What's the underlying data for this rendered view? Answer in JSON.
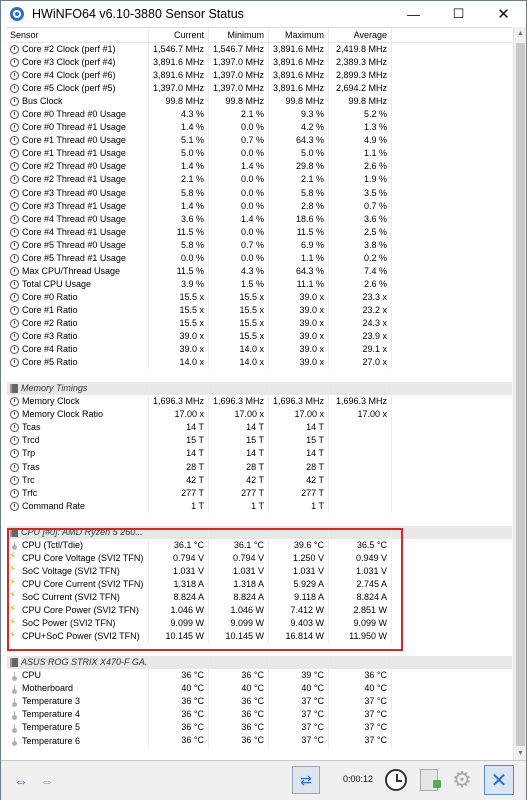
{
  "window": {
    "title": "HWiNFO64 v6.10-3880 Sensor Status"
  },
  "controls": {
    "minimize": "—",
    "maximize": "☐",
    "close": "✕"
  },
  "columns": [
    "Sensor",
    "Current",
    "Minimum",
    "Maximum",
    "Average"
  ],
  "rows": [
    {
      "type": "data",
      "icon": "clock",
      "label": "Core #2 Clock (perf #1)",
      "current": "1,546.7 MHz",
      "min": "1,546.7 MHz",
      "max": "3,891.6 MHz",
      "avg": "2,419.8 MHz"
    },
    {
      "type": "data",
      "icon": "clock",
      "label": "Core #3 Clock (perf #4)",
      "current": "3,891.6 MHz",
      "min": "1,397.0 MHz",
      "max": "3,891.6 MHz",
      "avg": "2,389.3 MHz"
    },
    {
      "type": "data",
      "icon": "clock",
      "label": "Core #4 Clock (perf #6)",
      "current": "3,891.6 MHz",
      "min": "1,397.0 MHz",
      "max": "3,891.6 MHz",
      "avg": "2,899.3 MHz"
    },
    {
      "type": "data",
      "icon": "clock",
      "label": "Core #5 Clock (perf #5)",
      "current": "1,397.0 MHz",
      "min": "1,397.0 MHz",
      "max": "3,891.6 MHz",
      "avg": "2,694.2 MHz"
    },
    {
      "type": "data",
      "icon": "clock",
      "label": "Bus Clock",
      "current": "99.8 MHz",
      "min": "99.8 MHz",
      "max": "99.8 MHz",
      "avg": "99.8 MHz"
    },
    {
      "type": "data",
      "icon": "clock",
      "label": "Core #0 Thread #0 Usage",
      "current": "4.3 %",
      "min": "2.1 %",
      "max": "9.3 %",
      "avg": "5.2 %"
    },
    {
      "type": "data",
      "icon": "clock",
      "label": "Core #0 Thread #1 Usage",
      "current": "1.4 %",
      "min": "0.0 %",
      "max": "4.2 %",
      "avg": "1.3 %"
    },
    {
      "type": "data",
      "icon": "clock",
      "label": "Core #1 Thread #0 Usage",
      "current": "5.1 %",
      "min": "0.7 %",
      "max": "64.3 %",
      "avg": "4.9 %"
    },
    {
      "type": "data",
      "icon": "clock",
      "label": "Core #1 Thread #1 Usage",
      "current": "5.0 %",
      "min": "0.0 %",
      "max": "5.0 %",
      "avg": "1.1 %"
    },
    {
      "type": "data",
      "icon": "clock",
      "label": "Core #2 Thread #0 Usage",
      "current": "1.4 %",
      "min": "1.4 %",
      "max": "29.8 %",
      "avg": "2.6 %"
    },
    {
      "type": "data",
      "icon": "clock",
      "label": "Core #2 Thread #1 Usage",
      "current": "2.1 %",
      "min": "0.0 %",
      "max": "2.1 %",
      "avg": "1.9 %"
    },
    {
      "type": "data",
      "icon": "clock",
      "label": "Core #3 Thread #0 Usage",
      "current": "5.8 %",
      "min": "0.0 %",
      "max": "5.8 %",
      "avg": "3.5 %"
    },
    {
      "type": "data",
      "icon": "clock",
      "label": "Core #3 Thread #1 Usage",
      "current": "1.4 %",
      "min": "0.0 %",
      "max": "2.8 %",
      "avg": "0.7 %"
    },
    {
      "type": "data",
      "icon": "clock",
      "label": "Core #4 Thread #0 Usage",
      "current": "3.6 %",
      "min": "1.4 %",
      "max": "18.6 %",
      "avg": "3.6 %"
    },
    {
      "type": "data",
      "icon": "clock",
      "label": "Core #4 Thread #1 Usage",
      "current": "11.5 %",
      "min": "0.0 %",
      "max": "11.5 %",
      "avg": "2.5 %"
    },
    {
      "type": "data",
      "icon": "clock",
      "label": "Core #5 Thread #0 Usage",
      "current": "5.8 %",
      "min": "0.7 %",
      "max": "6.9 %",
      "avg": "3.8 %"
    },
    {
      "type": "data",
      "icon": "clock",
      "label": "Core #5 Thread #1 Usage",
      "current": "0.0 %",
      "min": "0.0 %",
      "max": "1.1 %",
      "avg": "0.2 %"
    },
    {
      "type": "data",
      "icon": "clock",
      "label": "Max CPU/Thread Usage",
      "current": "11.5 %",
      "min": "4.3 %",
      "max": "64.3 %",
      "avg": "7.4 %"
    },
    {
      "type": "data",
      "icon": "clock",
      "label": "Total CPU Usage",
      "current": "3.9 %",
      "min": "1.5 %",
      "max": "11.1 %",
      "avg": "2.6 %"
    },
    {
      "type": "data",
      "icon": "clock",
      "label": "Core #0 Ratio",
      "current": "15.5 x",
      "min": "15.5 x",
      "max": "39.0 x",
      "avg": "23.3 x"
    },
    {
      "type": "data",
      "icon": "clock",
      "label": "Core #1 Ratio",
      "current": "15.5 x",
      "min": "15.5 x",
      "max": "39.0 x",
      "avg": "23.2 x"
    },
    {
      "type": "data",
      "icon": "clock",
      "label": "Core #2 Ratio",
      "current": "15.5 x",
      "min": "15.5 x",
      "max": "39.0 x",
      "avg": "24.3 x"
    },
    {
      "type": "data",
      "icon": "clock",
      "label": "Core #3 Ratio",
      "current": "39.0 x",
      "min": "15.5 x",
      "max": "39.0 x",
      "avg": "23.9 x"
    },
    {
      "type": "data",
      "icon": "clock",
      "label": "Core #4 Ratio",
      "current": "39.0 x",
      "min": "14.0 x",
      "max": "39.0 x",
      "avg": "29.1 x"
    },
    {
      "type": "data",
      "icon": "clock",
      "label": "Core #5 Ratio",
      "current": "14.0 x",
      "min": "14.0 x",
      "max": "39.0 x",
      "avg": "27.0 x"
    },
    {
      "type": "blank"
    },
    {
      "type": "group",
      "icon": "chip",
      "label": "Memory Timings"
    },
    {
      "type": "data",
      "icon": "clock",
      "label": "Memory Clock",
      "current": "1,696.3 MHz",
      "min": "1,696.3 MHz",
      "max": "1,696.3 MHz",
      "avg": "1,696.3 MHz"
    },
    {
      "type": "data",
      "icon": "clock",
      "label": "Memory Clock Ratio",
      "current": "17.00 x",
      "min": "17.00 x",
      "max": "17.00 x",
      "avg": "17.00 x"
    },
    {
      "type": "data",
      "icon": "clock",
      "label": "Tcas",
      "current": "14 T",
      "min": "14 T",
      "max": "14 T",
      "avg": ""
    },
    {
      "type": "data",
      "icon": "clock",
      "label": "Trcd",
      "current": "15 T",
      "min": "15 T",
      "max": "15 T",
      "avg": ""
    },
    {
      "type": "data",
      "icon": "clock",
      "label": "Trp",
      "current": "14 T",
      "min": "14 T",
      "max": "14 T",
      "avg": ""
    },
    {
      "type": "data",
      "icon": "clock",
      "label": "Tras",
      "current": "28 T",
      "min": "28 T",
      "max": "28 T",
      "avg": ""
    },
    {
      "type": "data",
      "icon": "clock",
      "label": "Trc",
      "current": "42 T",
      "min": "42 T",
      "max": "42 T",
      "avg": ""
    },
    {
      "type": "data",
      "icon": "clock",
      "label": "Trfc",
      "current": "277 T",
      "min": "277 T",
      "max": "277 T",
      "avg": ""
    },
    {
      "type": "data",
      "icon": "clock",
      "label": "Command Rate",
      "current": "1 T",
      "min": "1 T",
      "max": "1 T",
      "avg": ""
    },
    {
      "type": "blank"
    },
    {
      "type": "group",
      "icon": "chip",
      "label": "CPU [#0]: AMD Ryzen 5 260..."
    },
    {
      "type": "data",
      "icon": "temp",
      "label": "CPU (Tctl/Tdie)",
      "current": "36.1 °C",
      "min": "36.1 °C",
      "max": "39.6 °C",
      "avg": "36.5 °C"
    },
    {
      "type": "data",
      "icon": "volt",
      "label": "CPU Core Voltage (SVI2 TFN)",
      "current": "0.794 V",
      "min": "0.794 V",
      "max": "1.250 V",
      "avg": "0.949 V"
    },
    {
      "type": "data",
      "icon": "volt",
      "label": "SoC Voltage (SVI2 TFN)",
      "current": "1.031 V",
      "min": "1.031 V",
      "max": "1.031 V",
      "avg": "1.031 V"
    },
    {
      "type": "data",
      "icon": "volt",
      "label": "CPU Core Current (SVI2 TFN)",
      "current": "1.318 A",
      "min": "1.318 A",
      "max": "5.929 A",
      "avg": "2.745 A"
    },
    {
      "type": "data",
      "icon": "volt",
      "label": "SoC Current (SVI2 TFN)",
      "current": "8.824 A",
      "min": "8.824 A",
      "max": "9.118 A",
      "avg": "8.824 A"
    },
    {
      "type": "data",
      "icon": "volt",
      "label": "CPU Core Power (SVI2 TFN)",
      "current": "1.046 W",
      "min": "1.046 W",
      "max": "7.412 W",
      "avg": "2.851 W"
    },
    {
      "type": "data",
      "icon": "volt",
      "label": "SoC Power (SVI2 TFN)",
      "current": "9.099 W",
      "min": "9.099 W",
      "max": "9.403 W",
      "avg": "9.099 W"
    },
    {
      "type": "data",
      "icon": "volt",
      "label": "CPU+SoC Power (SVI2 TFN)",
      "current": "10.145 W",
      "min": "10.145 W",
      "max": "16.814 W",
      "avg": "11.950 W"
    },
    {
      "type": "blank"
    },
    {
      "type": "group",
      "icon": "chip",
      "label": "ASUS ROG STRIX X470-F GA..."
    },
    {
      "type": "data",
      "icon": "temp",
      "label": "CPU",
      "current": "36 °C",
      "min": "36 °C",
      "max": "39 °C",
      "avg": "36 °C"
    },
    {
      "type": "data",
      "icon": "temp",
      "label": "Motherboard",
      "current": "40 °C",
      "min": "40 °C",
      "max": "40 °C",
      "avg": "40 °C"
    },
    {
      "type": "data",
      "icon": "temp",
      "label": "Temperature 3",
      "current": "36 °C",
      "min": "36 °C",
      "max": "37 °C",
      "avg": "37 °C"
    },
    {
      "type": "data",
      "icon": "temp",
      "label": "Temperature 4",
      "current": "36 °C",
      "min": "36 °C",
      "max": "37 °C",
      "avg": "37 °C"
    },
    {
      "type": "data",
      "icon": "temp",
      "label": "Temperature 5",
      "current": "36 °C",
      "min": "36 °C",
      "max": "37 °C",
      "avg": "37 °C"
    },
    {
      "type": "data",
      "icon": "temp",
      "label": "Temperature 6",
      "current": "36 °C",
      "min": "36 °C",
      "max": "37 °C",
      "avg": "37 °C"
    }
  ],
  "toolbar": {
    "elapsed_time": "0:00:12"
  },
  "colors": {
    "highlight_border": "#d9252a",
    "accent_blue": "#2c66c8"
  }
}
